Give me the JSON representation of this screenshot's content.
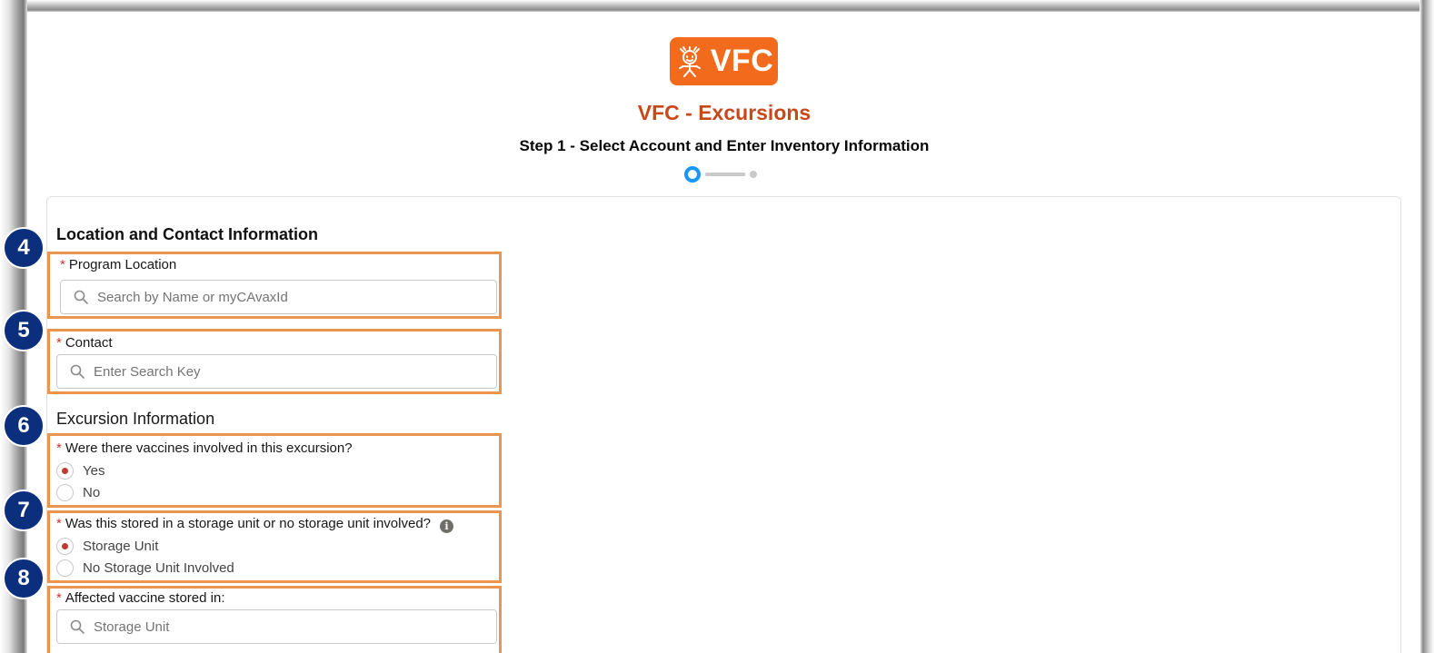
{
  "app": {
    "logo_text": "VFC",
    "title": "VFC - Excursions",
    "step_title": "Step 1 - Select Account and Enter Inventory Information"
  },
  "progress": {
    "current_step": 1,
    "total_steps": 2
  },
  "sections": {
    "location": {
      "title": "Location and Contact Information"
    },
    "excursion": {
      "title": "Excursion Information"
    }
  },
  "fields": {
    "program_location": {
      "label": "Program Location",
      "placeholder": "Search by Name or myCAvaxId"
    },
    "contact": {
      "label": "Contact",
      "placeholder": "Enter Search Key"
    },
    "vaccines_involved": {
      "label": "Were there vaccines involved in this excursion?",
      "options": [
        "Yes",
        "No"
      ],
      "selected": "Yes"
    },
    "storage_type": {
      "label": "Was this stored in a storage unit or no storage unit involved?",
      "info_icon": "i",
      "options": [
        "Storage Unit",
        "No Storage Unit Involved"
      ],
      "selected": "Storage Unit"
    },
    "stored_in": {
      "label": "Affected vaccine stored in:",
      "placeholder": "Storage Unit"
    }
  },
  "required_marker": "*",
  "callouts": [
    "4",
    "5",
    "6",
    "7",
    "8"
  ],
  "colors": {
    "brand_orange": "#f26b1d",
    "title_red": "#c8481a",
    "highlight_orange": "#ec9550",
    "callout_blue": "#0b2f7c",
    "progress_blue": "#1b96ff"
  }
}
